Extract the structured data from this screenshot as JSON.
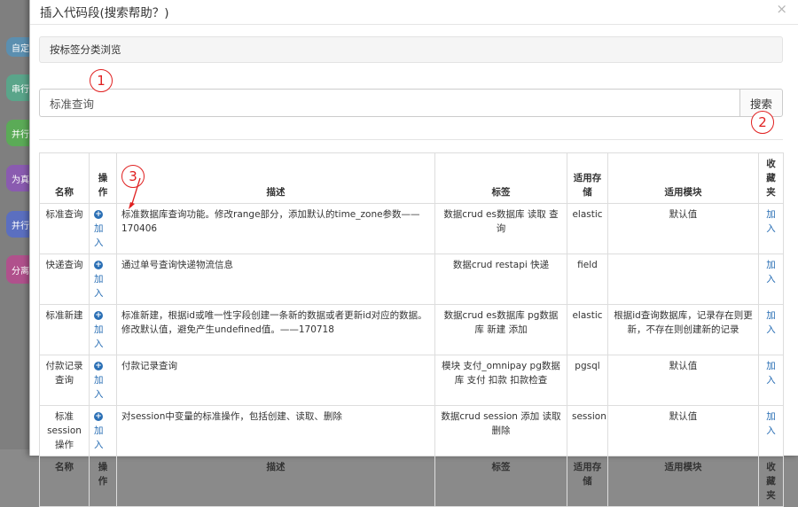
{
  "background_blocks": [
    {
      "label": "自定",
      "color": "#5b8fb0"
    },
    {
      "label": "串行",
      "color": "#5aa58a"
    },
    {
      "label": "并行",
      "color": "#5bab57"
    },
    {
      "label": "为真",
      "color": "#8a5bb0"
    },
    {
      "label": "并行",
      "color": "#5b6fc0"
    },
    {
      "label": "分离",
      "color": "#b0518c"
    }
  ],
  "modal": {
    "title": "插入代码段(搜索帮助？)",
    "close_label": "×",
    "browse_label": "按标签分类浏览",
    "search_value": "标准查询",
    "search_button": "搜索"
  },
  "markers": [
    "1",
    "2",
    "3"
  ],
  "table": {
    "headers": [
      "名称",
      "操作",
      "描述",
      "标签",
      "适用存储",
      "适用模块",
      "收藏夹"
    ],
    "add_label": "加入",
    "fav_label": "加入",
    "rows": [
      {
        "name": "标准查询",
        "desc": "标准数据库查询功能。修改range部分，添加默认的time_zone参数——170406",
        "tags": "数据crud es数据库 读取 查询",
        "storage": "elastic",
        "module": "默认值"
      },
      {
        "name": "快递查询",
        "desc": "通过单号查询快递物流信息",
        "tags": "数据crud restapi 快递",
        "storage": "field",
        "module": ""
      },
      {
        "name": "标准新建",
        "desc": "标准新建，根据id或唯一性字段创建一条新的数据或者更新id对应的数据。修改默认值，避免产生undefined值。——170718",
        "tags": "数据crud es数据库 pg数据库 新建 添加",
        "storage": "elastic",
        "module": "根据id查询数据库，记录存在则更新，不存在则创建新的记录"
      },
      {
        "name": "付款记录查询",
        "desc": "付款记录查询",
        "tags": "模块 支付_omnipay pg数据库 支付 扣款 扣款检查",
        "storage": "pgsql",
        "module": "默认值"
      },
      {
        "name": "标准session操作",
        "desc": "对session中变量的标准操作，包括创建、读取、删除",
        "tags": "数据crud session 添加 读取 删除",
        "storage": "session",
        "module": "默认值"
      }
    ]
  }
}
